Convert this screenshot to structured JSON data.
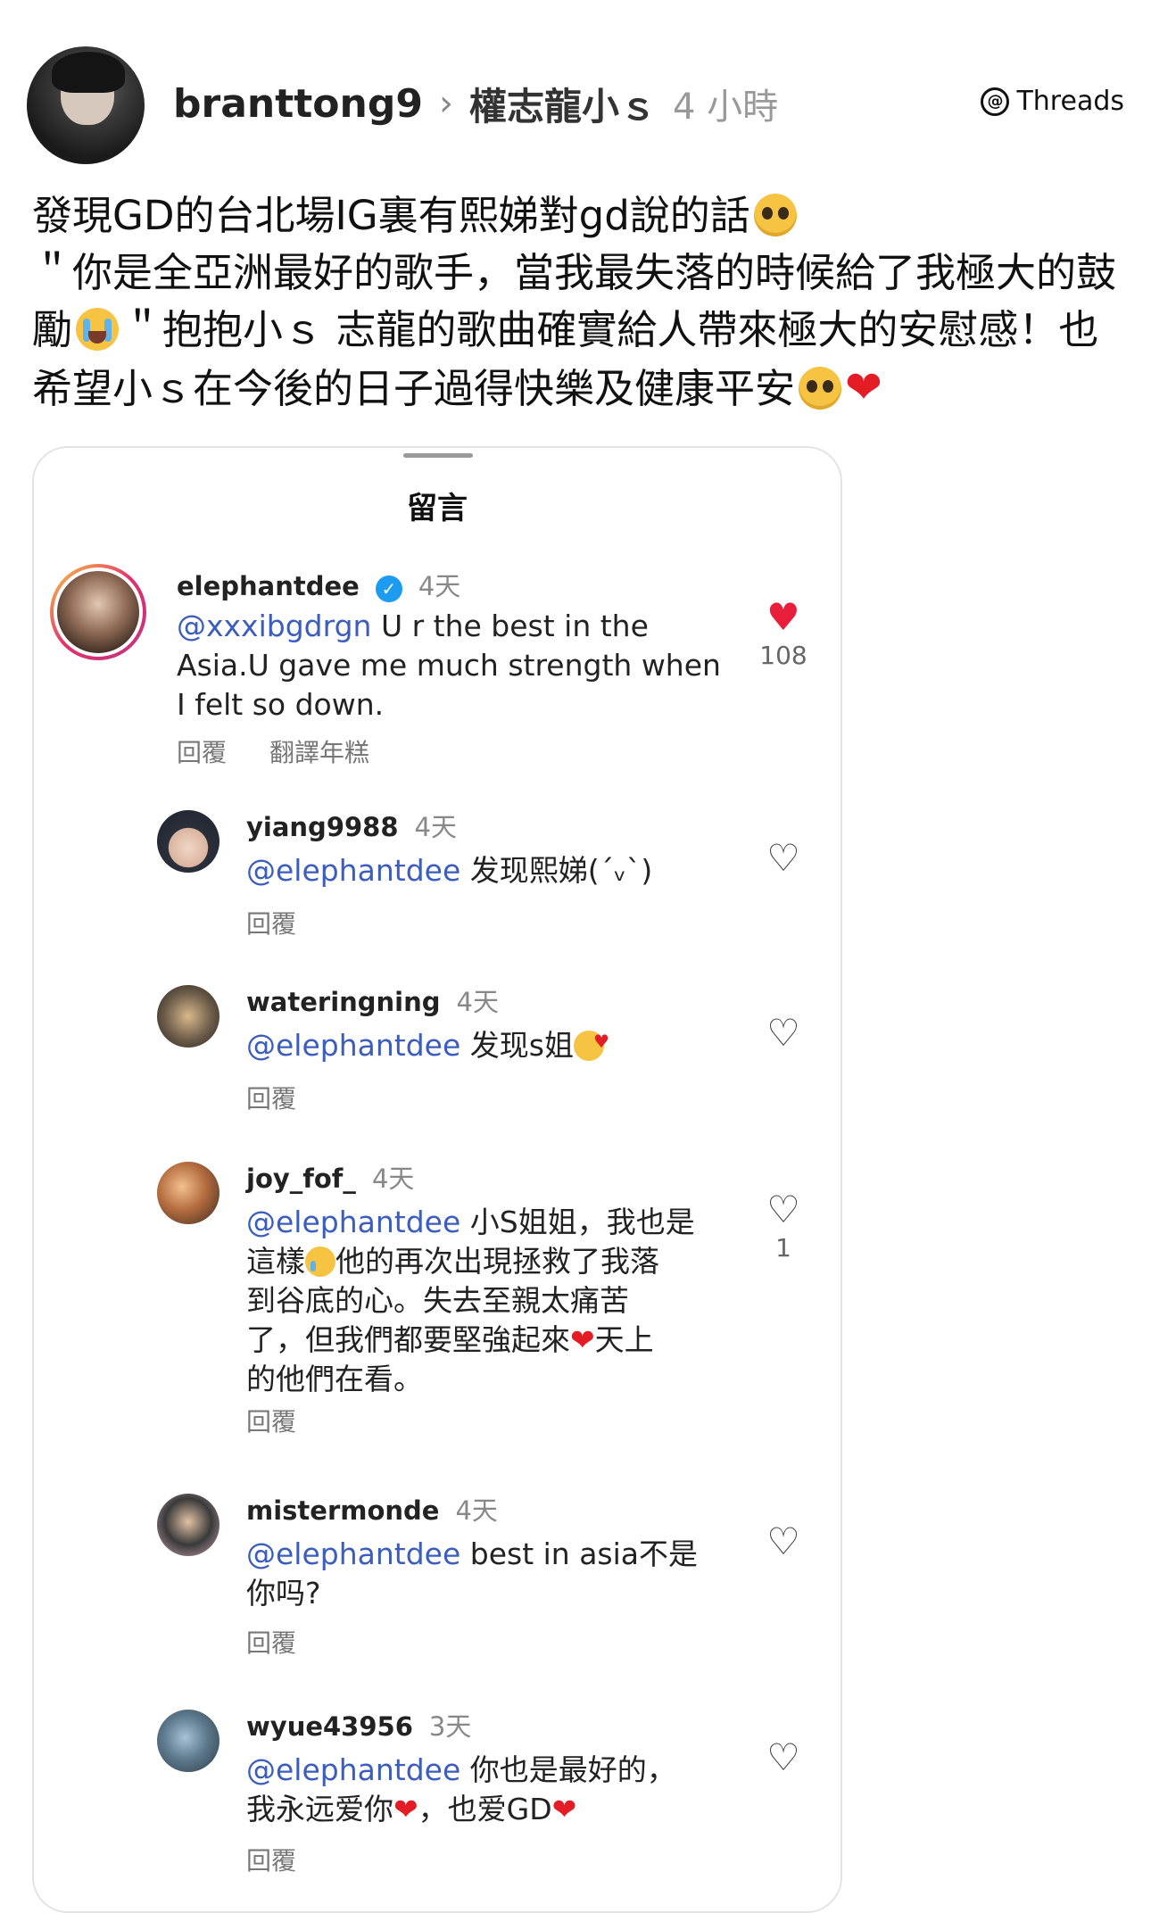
{
  "post": {
    "username": "branttong9",
    "topic": "權志龍小ｓ",
    "time": "4 小時",
    "brand": "Threads",
    "line1": "發現GD的台北場IG裏有熙娣對gd說的話",
    "line2": "＂你是全亞洲最好的歌手，當我最失落的時候給了我極大的鼓",
    "line3a": "勵",
    "line3b": "＂抱抱小ｓ 志龍的歌曲確實給人帶來極大的安慰感！也",
    "line4": "希望小ｓ在今後的日子過得快樂及健康平安"
  },
  "card": {
    "title": "留言",
    "comments": [
      {
        "user": "elephantdee",
        "time": "4天",
        "mention": "@xxxibgdrgn",
        "text1": " U r the best in the",
        "text2": "Asia.U gave me much strength when",
        "text3": "I felt so down.",
        "reply": "回覆",
        "translate": "翻譯年糕",
        "likes": "108"
      },
      {
        "user": "yiang9988",
        "time": "4天",
        "mention": "@elephantdee",
        "text": " 发现熙娣(ˊᵥˋ)",
        "reply": "回覆"
      },
      {
        "user": "wateringning",
        "time": "4天",
        "mention": "@elephantdee",
        "text": " 发现s姐",
        "reply": "回覆"
      },
      {
        "user": "joy_fof_",
        "time": "4天",
        "mention": "@elephantdee",
        "text1": " 小S姐姐，我也是",
        "text2a": "這樣",
        "text2b": "他的再次出現拯救了我落",
        "text3": "到谷底的心。失去至親太痛苦",
        "text4a": "了，但我們都要堅強起來",
        "text4b": "天上",
        "text5": "的他們在看。",
        "reply": "回覆",
        "likes": "1"
      },
      {
        "user": "mistermonde",
        "time": "4天",
        "mention": "@elephantdee",
        "text1": " best in asia不是",
        "text2": "你吗?",
        "reply": "回覆"
      },
      {
        "user": "wyue43956",
        "time": "3天",
        "mention": "@elephantdee",
        "text1": " 你也是最好的，",
        "text2a": "我永远爱你",
        "text2b": "，也爱GD",
        "reply": "回覆"
      }
    ]
  },
  "icons": {
    "verified": "verified-badge-icon",
    "like": "heart-outline-icon",
    "liked": "heart-filled-icon",
    "brand": "threads-logo-icon"
  },
  "colors": {
    "mention": "#3b5dbe",
    "heart": "#e31c25",
    "verified": "#1d9bf0"
  }
}
